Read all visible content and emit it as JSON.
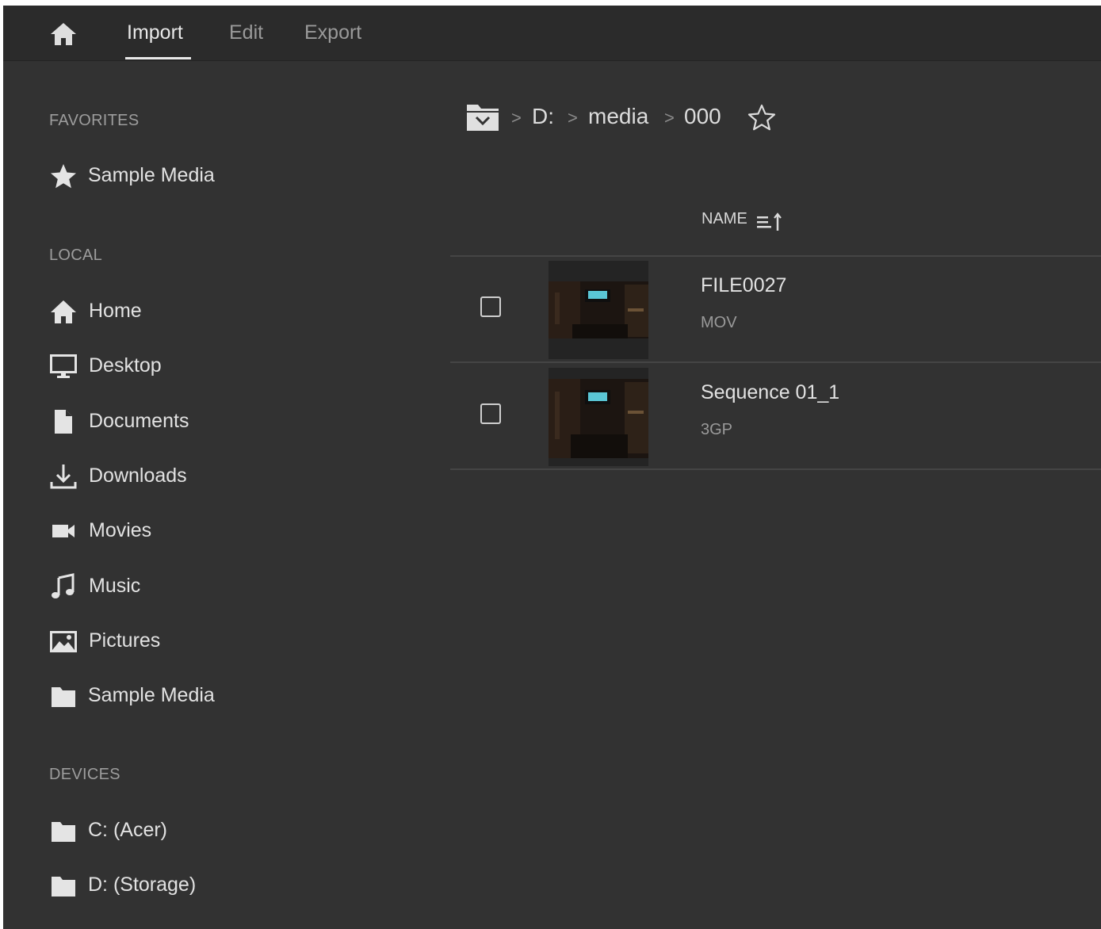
{
  "header": {
    "tabs": [
      {
        "label": "Import",
        "active": true
      },
      {
        "label": "Edit",
        "active": false
      },
      {
        "label": "Export",
        "active": false
      }
    ]
  },
  "sidebar": {
    "favorites": {
      "title": "FAVORITES",
      "items": [
        {
          "label": "Sample Media",
          "icon": "star-icon"
        }
      ]
    },
    "local": {
      "title": "LOCAL",
      "items": [
        {
          "label": "Home",
          "icon": "home-icon"
        },
        {
          "label": "Desktop",
          "icon": "desktop-icon"
        },
        {
          "label": "Documents",
          "icon": "document-icon"
        },
        {
          "label": "Downloads",
          "icon": "download-icon"
        },
        {
          "label": "Movies",
          "icon": "video-camera-icon"
        },
        {
          "label": "Music",
          "icon": "music-note-icon"
        },
        {
          "label": "Pictures",
          "icon": "picture-icon"
        },
        {
          "label": "Sample Media",
          "icon": "folder-icon"
        }
      ]
    },
    "devices": {
      "title": "DEVICES",
      "items": [
        {
          "label": "C: (Acer)",
          "icon": "folder-icon"
        },
        {
          "label": "D: (Storage)",
          "icon": "folder-icon"
        }
      ]
    }
  },
  "breadcrumb": {
    "segments": [
      "D:",
      "media",
      "000"
    ],
    "separator": ">"
  },
  "file_list": {
    "column_header": "NAME",
    "sort_order": "ascending",
    "files": [
      {
        "name": "FILE0027",
        "type": "MOV",
        "checked": false
      },
      {
        "name": "Sequence 01_1",
        "type": "3GP",
        "checked": false
      }
    ]
  },
  "colors": {
    "background": "#323232",
    "header_background": "#2b2b2b",
    "text_primary": "#e2e2e2",
    "text_secondary": "#9d9d9d"
  }
}
